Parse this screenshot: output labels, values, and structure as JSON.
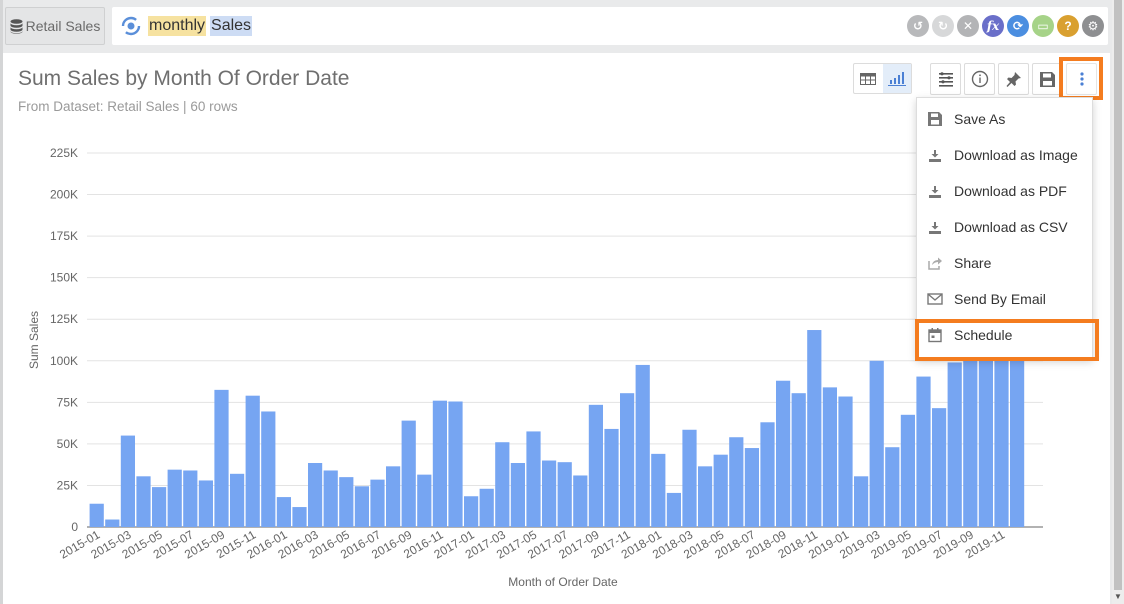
{
  "topbar": {
    "dataset_label": "Retail Sales",
    "search_tokens": [
      "monthly",
      "Sales"
    ],
    "tool_icons": [
      {
        "name": "undo-icon",
        "color": "#b8b9bb",
        "glyph": "↺"
      },
      {
        "name": "redo-icon",
        "color": "#d7d8d9",
        "glyph": "↻"
      },
      {
        "name": "clear-icon",
        "color": "#b3b4b6",
        "glyph": "✕"
      },
      {
        "name": "formula-icon",
        "color": "#6a6fc9",
        "glyph": "fx"
      },
      {
        "name": "refresh-icon",
        "color": "#4b8ee0",
        "glyph": "⟳"
      },
      {
        "name": "folder-icon",
        "color": "#a6d388",
        "glyph": "▭"
      },
      {
        "name": "help-icon",
        "color": "#d9a030",
        "glyph": "?"
      },
      {
        "name": "settings-icon",
        "color": "#8e8f91",
        "glyph": "⚙"
      }
    ]
  },
  "panel": {
    "title": "Sum Sales by Month Of Order Date",
    "subtitle": "From Dataset: Retail Sales | 60 rows"
  },
  "menu": {
    "items": [
      {
        "label": "Save As",
        "icon": "save-icon"
      },
      {
        "label": "Download as Image",
        "icon": "download-icon"
      },
      {
        "label": "Download as PDF",
        "icon": "download-icon"
      },
      {
        "label": "Download as CSV",
        "icon": "download-icon"
      },
      {
        "label": "Share",
        "icon": "share-icon"
      },
      {
        "label": "Send By Email",
        "icon": "email-icon"
      },
      {
        "label": "Schedule",
        "icon": "calendar-icon"
      }
    ],
    "highlighted": "Schedule"
  },
  "colors": {
    "bar": "#76a5f2",
    "highlight": "#f47c1f",
    "accent": "#4a7fd4"
  },
  "chart_data": {
    "type": "bar",
    "title": "Sum Sales by Month Of Order Date",
    "xlabel": "Month of Order Date",
    "ylabel": "Sum Sales",
    "ylim": [
      0,
      225000
    ],
    "yticks": [
      0,
      25000,
      50000,
      75000,
      100000,
      125000,
      150000,
      175000,
      200000,
      225000
    ],
    "ytick_labels": [
      "0",
      "25K",
      "50K",
      "75K",
      "100K",
      "125K",
      "150K",
      "175K",
      "200K",
      "225K"
    ],
    "grid": true,
    "legend": "none",
    "categories": [
      "2015-01",
      "2015-02",
      "2015-03",
      "2015-04",
      "2015-05",
      "2015-06",
      "2015-07",
      "2015-08",
      "2015-09",
      "2015-10",
      "2015-11",
      "2015-12",
      "2016-01",
      "2016-02",
      "2016-03",
      "2016-04",
      "2016-05",
      "2016-06",
      "2016-07",
      "2016-08",
      "2016-09",
      "2016-10",
      "2016-11",
      "2016-12",
      "2017-01",
      "2017-02",
      "2017-03",
      "2017-04",
      "2017-05",
      "2017-06",
      "2017-07",
      "2017-08",
      "2017-09",
      "2017-10",
      "2017-11",
      "2017-12",
      "2018-01",
      "2018-02",
      "2018-03",
      "2018-04",
      "2018-05",
      "2018-06",
      "2018-07",
      "2018-08",
      "2018-09",
      "2018-10",
      "2018-11",
      "2018-12",
      "2019-01",
      "2019-02",
      "2019-03",
      "2019-04",
      "2019-05",
      "2019-06",
      "2019-07",
      "2019-08",
      "2019-09",
      "2019-10",
      "2019-11",
      "2019-12"
    ],
    "xtick_labels": [
      "2015-01",
      "2015-03",
      "2015-05",
      "2015-07",
      "2015-09",
      "2015-11",
      "2016-01",
      "2016-03",
      "2016-05",
      "2016-07",
      "2016-09",
      "2016-11",
      "2017-01",
      "2017-03",
      "2017-05",
      "2017-07",
      "2017-09",
      "2017-11",
      "2018-01",
      "2018-03",
      "2018-05",
      "2018-07",
      "2018-09",
      "2018-11",
      "2019-01",
      "2019-03",
      "2019-05",
      "2019-07",
      "2019-09",
      "2019-11"
    ],
    "series": [
      {
        "name": "Sum Sales",
        "values": [
          14000,
          4500,
          55000,
          30500,
          24000,
          34500,
          34000,
          28000,
          82500,
          32000,
          79000,
          69500,
          18000,
          12000,
          38500,
          34000,
          30000,
          24500,
          28500,
          36500,
          64000,
          31500,
          76000,
          75500,
          18500,
          23000,
          51000,
          38500,
          57500,
          40000,
          39000,
          31000,
          73500,
          59000,
          80500,
          97500,
          44000,
          20500,
          58500,
          36500,
          43500,
          54000,
          47500,
          63000,
          88000,
          80500,
          118500,
          84000,
          78500,
          30500,
          100000,
          48000,
          67500,
          90500,
          71500,
          99000,
          106000,
          108000,
          110000,
          105000
        ]
      }
    ]
  }
}
